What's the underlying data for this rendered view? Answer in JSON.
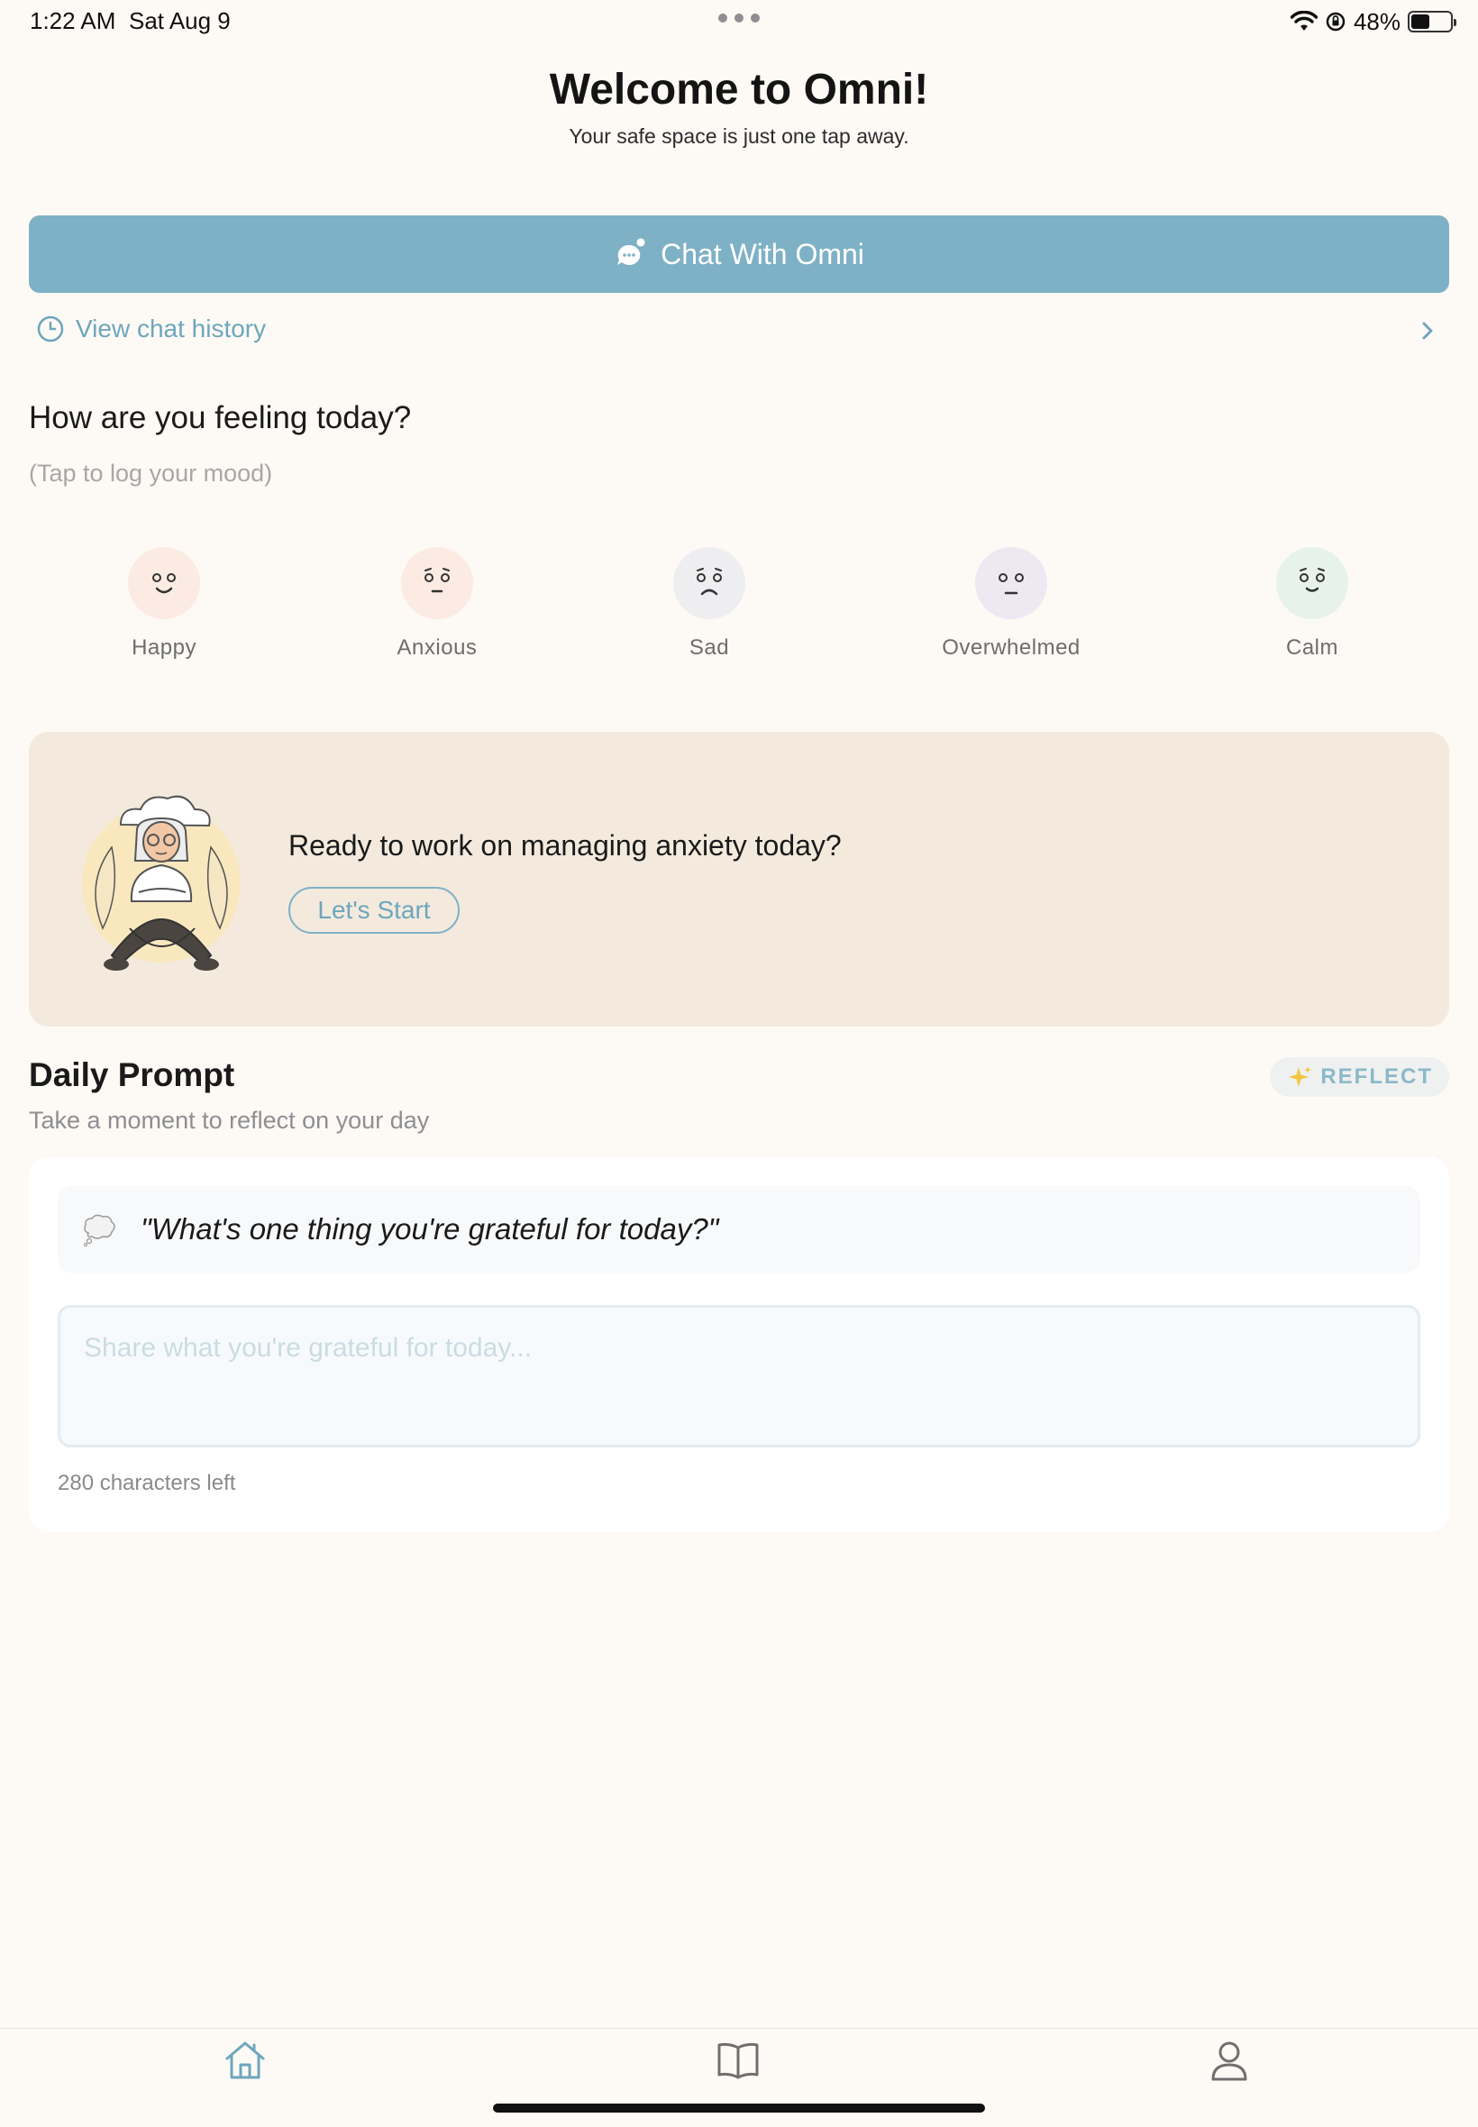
{
  "status_bar": {
    "time": "1:22 AM",
    "date": "Sat Aug 9",
    "battery": "48%",
    "battery_level": 0.48
  },
  "header": {
    "title": "Welcome to Omni!",
    "subtitle": "Your safe space is just one tap away."
  },
  "chat": {
    "button_label": "Chat With Omni",
    "history_link": "View chat history"
  },
  "mood": {
    "heading": "How are you feeling today?",
    "subheading": "(Tap to log your mood)",
    "items": [
      {
        "label": "Happy",
        "color": "#FBEBE2"
      },
      {
        "label": "Anxious",
        "color": "#FBEBE2"
      },
      {
        "label": "Sad",
        "color": "#EEEEF1"
      },
      {
        "label": "Overwhelmed",
        "color": "#EEE8F2"
      },
      {
        "label": "Calm",
        "color": "#E8F2EC"
      }
    ]
  },
  "anxiety_card": {
    "text": "Ready to work on managing anxiety today?",
    "button_label": "Let's Start"
  },
  "daily_prompt": {
    "heading": "Daily Prompt",
    "subheading": "Take a moment to reflect on your day",
    "badge": "REFLECT",
    "question": "\"What's one thing you're grateful for today?\"",
    "input_placeholder": "Share what you're grateful for today...",
    "input_value": "",
    "char_count": "280 characters left"
  },
  "tabs": [
    {
      "name": "home",
      "icon": "home-icon",
      "active": true
    },
    {
      "name": "journal",
      "icon": "book-icon",
      "active": false
    },
    {
      "name": "profile",
      "icon": "person-icon",
      "active": false
    }
  ],
  "colors": {
    "background": "#FDFAF5",
    "accent": "#7FB1C6",
    "card": "#F3EADD"
  }
}
